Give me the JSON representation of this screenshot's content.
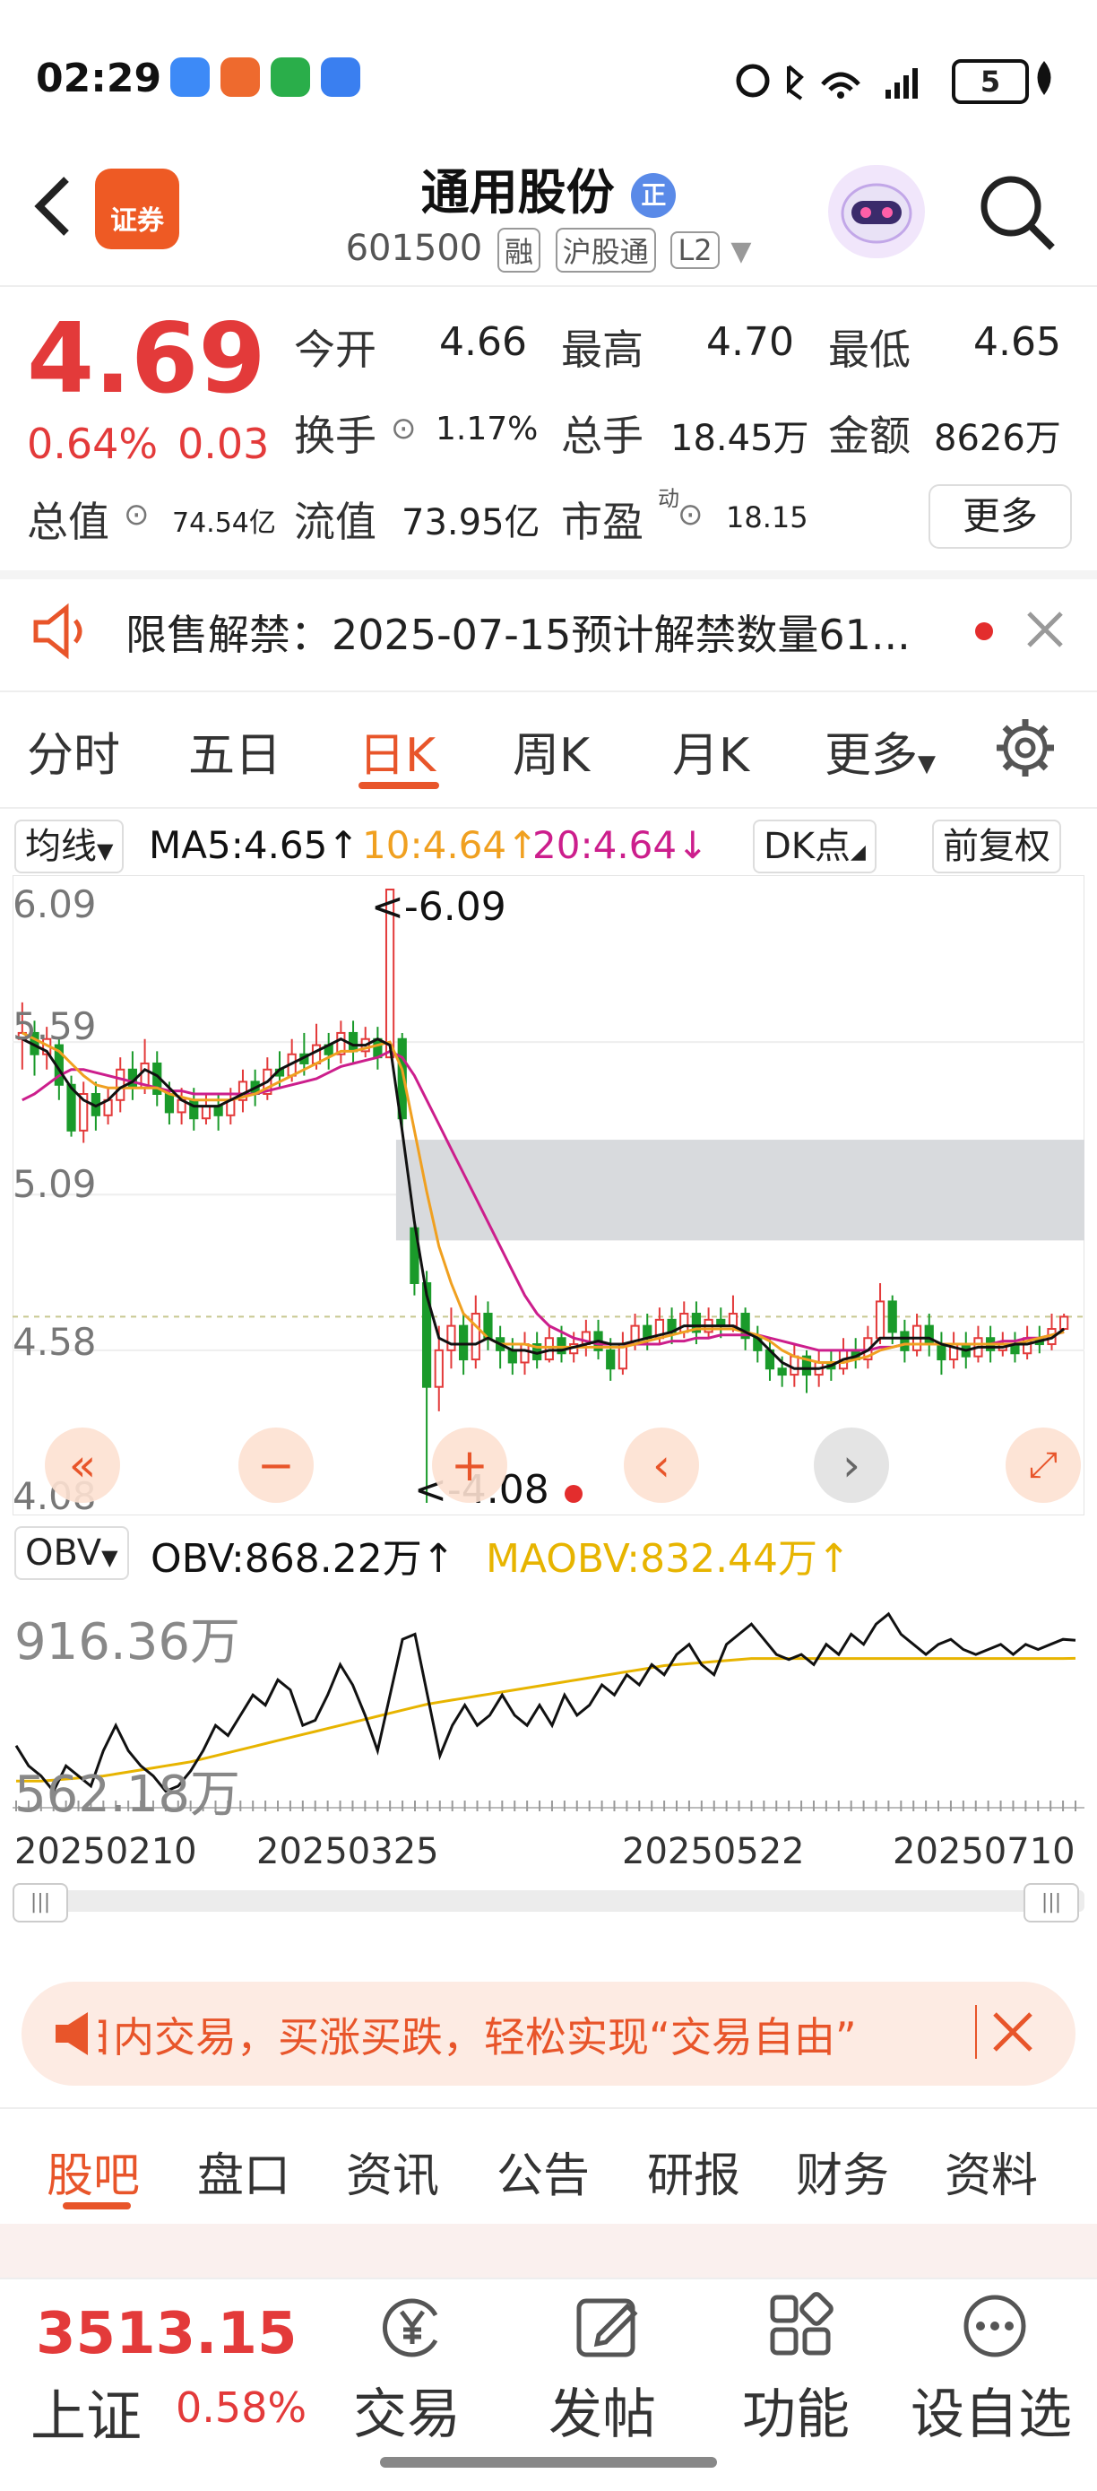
{
  "status_bar": {
    "time": "02:29",
    "battery": "5"
  },
  "header": {
    "stock_name": "通用股份",
    "badge": "正",
    "code": "601500",
    "tags": [
      "融",
      "沪股通",
      "L2"
    ],
    "app_badge": "证券"
  },
  "quote": {
    "price": "4.69",
    "change_pct": "0.64%",
    "change": "0.03",
    "open_label": "今开",
    "open": "4.66",
    "high_label": "最高",
    "high": "4.70",
    "low_label": "最低",
    "low": "4.65",
    "turnover_label": "换手",
    "turnover": "1.17%",
    "volume_label": "总手",
    "volume": "18.45万",
    "amount_label": "金额",
    "amount": "8626万",
    "mktcap_label": "总值",
    "mktcap": "74.54亿",
    "float_label": "流值",
    "float": "73.95亿",
    "pe_label": "市盈",
    "pe_sup": "动",
    "pe": "18.15",
    "more_label": "更多"
  },
  "notice": {
    "text": "限售解禁：2025-07-15预计解禁数量61..."
  },
  "chart_tabs": [
    {
      "label": "分时"
    },
    {
      "label": "五日"
    },
    {
      "label": "日K"
    },
    {
      "label": "周K"
    },
    {
      "label": "月K"
    },
    {
      "label": "更多"
    }
  ],
  "ma_bar": {
    "selector": "均线",
    "ma5": "MA5:4.65↑",
    "ma10": "10:4.64↑",
    "ma20": "20:4.64↓",
    "dk": "DK点",
    "adjust": "前复权"
  },
  "colors": {
    "ma5": "#111111",
    "ma10": "#f0a020",
    "ma20": "#cc1e8c",
    "up": "#e33a3a",
    "down": "#1a9a2a",
    "accent": "#e8552a"
  },
  "chart_data": {
    "type": "candlestick",
    "y_ticks": [
      "6.09",
      "5.59",
      "5.09",
      "4.58",
      "4.08"
    ],
    "ylim": [
      4.08,
      6.09
    ],
    "annotations": {
      "max": "<-6.09",
      "min": "<-4.08"
    },
    "x_ticks": [
      "20250210",
      "20250325",
      "20250522",
      "20250710"
    ],
    "candles": [
      [
        5.6,
        5.62,
        5.72,
        5.5
      ],
      [
        5.62,
        5.55,
        5.66,
        5.48
      ],
      [
        5.55,
        5.6,
        5.64,
        5.5
      ],
      [
        5.58,
        5.45,
        5.6,
        5.4
      ],
      [
        5.45,
        5.3,
        5.48,
        5.28
      ],
      [
        5.3,
        5.42,
        5.46,
        5.26
      ],
      [
        5.42,
        5.35,
        5.46,
        5.3
      ],
      [
        5.35,
        5.4,
        5.44,
        5.32
      ],
      [
        5.4,
        5.5,
        5.54,
        5.36
      ],
      [
        5.5,
        5.44,
        5.56,
        5.4
      ],
      [
        5.44,
        5.52,
        5.6,
        5.42
      ],
      [
        5.52,
        5.42,
        5.56,
        5.38
      ],
      [
        5.42,
        5.36,
        5.46,
        5.32
      ],
      [
        5.36,
        5.4,
        5.44,
        5.32
      ],
      [
        5.4,
        5.34,
        5.44,
        5.3
      ],
      [
        5.34,
        5.38,
        5.42,
        5.32
      ],
      [
        5.38,
        5.35,
        5.42,
        5.3
      ],
      [
        5.35,
        5.4,
        5.44,
        5.32
      ],
      [
        5.4,
        5.46,
        5.5,
        5.36
      ],
      [
        5.46,
        5.42,
        5.5,
        5.38
      ],
      [
        5.42,
        5.5,
        5.54,
        5.4
      ],
      [
        5.5,
        5.48,
        5.56,
        5.44
      ],
      [
        5.48,
        5.55,
        5.6,
        5.46
      ],
      [
        5.55,
        5.52,
        5.62,
        5.48
      ],
      [
        5.52,
        5.58,
        5.65,
        5.5
      ],
      [
        5.58,
        5.55,
        5.62,
        5.5
      ],
      [
        5.55,
        5.62,
        5.66,
        5.52
      ],
      [
        5.62,
        5.56,
        5.66,
        5.52
      ],
      [
        5.56,
        5.6,
        5.64,
        5.54
      ],
      [
        5.6,
        5.54,
        5.64,
        5.5
      ],
      [
        5.54,
        6.09,
        6.09,
        5.54
      ],
      [
        5.6,
        5.34,
        5.62,
        5.3
      ],
      [
        4.98,
        4.8,
        5.0,
        4.76
      ],
      [
        4.8,
        4.46,
        4.84,
        4.08
      ],
      [
        4.46,
        4.58,
        4.66,
        4.38
      ],
      [
        4.58,
        4.66,
        4.72,
        4.52
      ],
      [
        4.66,
        4.55,
        4.7,
        4.5
      ],
      [
        4.55,
        4.7,
        4.76,
        4.52
      ],
      [
        4.7,
        4.62,
        4.74,
        4.58
      ],
      [
        4.62,
        4.58,
        4.66,
        4.52
      ],
      [
        4.58,
        4.54,
        4.62,
        4.5
      ],
      [
        4.54,
        4.6,
        4.64,
        4.5
      ],
      [
        4.6,
        4.55,
        4.64,
        4.52
      ],
      [
        4.55,
        4.62,
        4.66,
        4.54
      ],
      [
        4.62,
        4.57,
        4.66,
        4.54
      ],
      [
        4.57,
        4.6,
        4.64,
        4.54
      ],
      [
        4.6,
        4.64,
        4.68,
        4.56
      ],
      [
        4.64,
        4.58,
        4.68,
        4.55
      ],
      [
        4.58,
        4.52,
        4.62,
        4.48
      ],
      [
        4.52,
        4.6,
        4.64,
        4.5
      ],
      [
        4.6,
        4.66,
        4.7,
        4.58
      ],
      [
        4.66,
        4.62,
        4.7,
        4.58
      ],
      [
        4.62,
        4.68,
        4.72,
        4.6
      ],
      [
        4.68,
        4.64,
        4.72,
        4.6
      ],
      [
        4.64,
        4.7,
        4.74,
        4.62
      ],
      [
        4.7,
        4.64,
        4.74,
        4.6
      ],
      [
        4.64,
        4.68,
        4.72,
        4.62
      ],
      [
        4.68,
        4.66,
        4.72,
        4.62
      ],
      [
        4.66,
        4.7,
        4.76,
        4.64
      ],
      [
        4.7,
        4.62,
        4.72,
        4.58
      ],
      [
        4.62,
        4.58,
        4.66,
        4.54
      ],
      [
        4.58,
        4.52,
        4.62,
        4.48
      ],
      [
        4.52,
        4.5,
        4.56,
        4.46
      ],
      [
        4.5,
        4.56,
        4.6,
        4.46
      ],
      [
        4.56,
        4.5,
        4.58,
        4.44
      ],
      [
        4.5,
        4.54,
        4.58,
        4.46
      ],
      [
        4.54,
        4.52,
        4.58,
        4.48
      ],
      [
        4.52,
        4.58,
        4.62,
        4.5
      ],
      [
        4.58,
        4.55,
        4.62,
        4.52
      ],
      [
        4.55,
        4.62,
        4.66,
        4.52
      ],
      [
        4.62,
        4.74,
        4.8,
        4.6
      ],
      [
        4.74,
        4.64,
        4.76,
        4.6
      ],
      [
        4.64,
        4.58,
        4.68,
        4.54
      ],
      [
        4.58,
        4.66,
        4.7,
        4.56
      ],
      [
        4.66,
        4.6,
        4.7,
        4.56
      ],
      [
        4.6,
        4.55,
        4.64,
        4.5
      ],
      [
        4.55,
        4.6,
        4.64,
        4.52
      ],
      [
        4.6,
        4.56,
        4.64,
        4.52
      ],
      [
        4.56,
        4.62,
        4.66,
        4.54
      ],
      [
        4.62,
        4.58,
        4.66,
        4.54
      ],
      [
        4.58,
        4.6,
        4.64,
        4.56
      ],
      [
        4.6,
        4.57,
        4.64,
        4.54
      ],
      [
        4.57,
        4.62,
        4.66,
        4.55
      ],
      [
        4.62,
        4.6,
        4.66,
        4.57
      ],
      [
        4.6,
        4.65,
        4.7,
        4.58
      ],
      [
        4.65,
        4.69,
        4.7,
        4.65
      ]
    ],
    "ma5_values": [
      5.6,
      5.58,
      5.56,
      5.5,
      5.44,
      5.4,
      5.38,
      5.4,
      5.44,
      5.46,
      5.5,
      5.48,
      5.44,
      5.4,
      5.38,
      5.38,
      5.38,
      5.4,
      5.42,
      5.44,
      5.46,
      5.5,
      5.52,
      5.54,
      5.56,
      5.58,
      5.6,
      5.58,
      5.58,
      5.6,
      5.58,
      5.3,
      5.0,
      4.76,
      4.62,
      4.6,
      4.6,
      4.6,
      4.62,
      4.6,
      4.58,
      4.58,
      4.57,
      4.58,
      4.58,
      4.59,
      4.6,
      4.61,
      4.6,
      4.6,
      4.61,
      4.62,
      4.63,
      4.64,
      4.66,
      4.66,
      4.66,
      4.66,
      4.66,
      4.64,
      4.62,
      4.58,
      4.54,
      4.52,
      4.52,
      4.52,
      4.53,
      4.55,
      4.56,
      4.58,
      4.62,
      4.62,
      4.62,
      4.62,
      4.62,
      4.6,
      4.59,
      4.58,
      4.59,
      4.59,
      4.59,
      4.6,
      4.6,
      4.61,
      4.62,
      4.65
    ],
    "ma10_values": [
      5.62,
      5.6,
      5.58,
      5.56,
      5.52,
      5.48,
      5.45,
      5.44,
      5.44,
      5.44,
      5.44,
      5.44,
      5.42,
      5.41,
      5.4,
      5.4,
      5.4,
      5.4,
      5.41,
      5.42,
      5.44,
      5.46,
      5.48,
      5.5,
      5.52,
      5.54,
      5.56,
      5.56,
      5.57,
      5.58,
      5.59,
      5.5,
      5.3,
      5.1,
      4.92,
      4.8,
      4.7,
      4.66,
      4.62,
      4.6,
      4.6,
      4.6,
      4.59,
      4.59,
      4.59,
      4.59,
      4.59,
      4.59,
      4.59,
      4.59,
      4.6,
      4.61,
      4.62,
      4.63,
      4.64,
      4.65,
      4.65,
      4.65,
      4.65,
      4.64,
      4.63,
      4.61,
      4.58,
      4.56,
      4.55,
      4.54,
      4.54,
      4.54,
      4.55,
      4.56,
      4.58,
      4.59,
      4.6,
      4.6,
      4.6,
      4.6,
      4.6,
      4.6,
      4.6,
      4.6,
      4.6,
      4.6,
      4.61,
      4.62,
      4.63,
      4.64
    ],
    "ma20_values": [
      5.4,
      5.42,
      5.45,
      5.48,
      5.5,
      5.5,
      5.49,
      5.48,
      5.47,
      5.46,
      5.45,
      5.44,
      5.43,
      5.43,
      5.42,
      5.42,
      5.42,
      5.42,
      5.42,
      5.42,
      5.43,
      5.44,
      5.45,
      5.46,
      5.47,
      5.49,
      5.51,
      5.52,
      5.53,
      5.54,
      5.56,
      5.54,
      5.48,
      5.4,
      5.32,
      5.24,
      5.16,
      5.08,
      5.0,
      4.92,
      4.84,
      4.76,
      4.7,
      4.66,
      4.64,
      4.62,
      4.61,
      4.6,
      4.6,
      4.6,
      4.6,
      4.6,
      4.6,
      4.61,
      4.61,
      4.62,
      4.62,
      4.63,
      4.63,
      4.63,
      4.63,
      4.62,
      4.61,
      4.6,
      4.59,
      4.58,
      4.58,
      4.58,
      4.58,
      4.58,
      4.59,
      4.59,
      4.6,
      4.6,
      4.6,
      4.6,
      4.6,
      4.6,
      4.6,
      4.6,
      4.61,
      4.61,
      4.62,
      4.62,
      4.63,
      4.64
    ],
    "shaded_zone": {
      "from_candle": 31,
      "upper": 5.27,
      "lower": 4.94
    },
    "obv": {
      "label": "OBV",
      "obv_text": "OBV:868.22万↑",
      "maobv_text": "MAOBV:832.44万↑",
      "y_ticks": [
        "916.36万",
        "562.18万"
      ],
      "ylim": [
        562.18,
        916.36
      ],
      "obv_values": [
        660,
        620,
        600,
        570,
        620,
        600,
        580,
        650,
        700,
        650,
        620,
        600,
        570,
        580,
        610,
        650,
        700,
        680,
        720,
        760,
        740,
        790,
        770,
        700,
        710,
        760,
        820,
        780,
        720,
        650,
        760,
        870,
        880,
        760,
        640,
        700,
        740,
        700,
        720,
        760,
        720,
        700,
        740,
        700,
        760,
        720,
        740,
        780,
        760,
        800,
        780,
        820,
        800,
        840,
        860,
        820,
        800,
        860,
        880,
        900,
        870,
        840,
        830,
        840,
        820,
        860,
        840,
        880,
        860,
        900,
        920,
        880,
        860,
        840,
        860,
        870,
        850,
        840,
        850,
        860,
        840,
        860,
        850,
        860,
        870,
        868.22
      ],
      "maobv_values": [
        590,
        590,
        590,
        592,
        594,
        596,
        598,
        600,
        604,
        608,
        612,
        616,
        620,
        624,
        628,
        634,
        640,
        646,
        652,
        658,
        664,
        670,
        676,
        682,
        688,
        694,
        700,
        706,
        712,
        718,
        724,
        730,
        736,
        742,
        746,
        750,
        754,
        758,
        762,
        766,
        770,
        774,
        778,
        782,
        786,
        790,
        794,
        798,
        802,
        806,
        810,
        814,
        818,
        820,
        822,
        824,
        826,
        828,
        830,
        832,
        832,
        832,
        832,
        832,
        832,
        832,
        832,
        832,
        832,
        832,
        832,
        832,
        832,
        832,
        832,
        832,
        832,
        832,
        832,
        832,
        832,
        832,
        832,
        832,
        832,
        832.44
      ]
    }
  },
  "ad_banner": {
    "text": "日内交易，买涨买跌，轻松实现“交易自由”"
  },
  "bottom_tabs": [
    {
      "label": "股吧"
    },
    {
      "label": "盘口"
    },
    {
      "label": "资讯"
    },
    {
      "label": "公告"
    },
    {
      "label": "研报"
    },
    {
      "label": "财务"
    },
    {
      "label": "资料"
    }
  ],
  "bottom_nav": {
    "index_value": "3513.15",
    "index_name": "上证",
    "index_change": "0.58%",
    "items": [
      {
        "label": "交易"
      },
      {
        "label": "发帖"
      },
      {
        "label": "功能"
      },
      {
        "label": "设自选"
      }
    ]
  }
}
